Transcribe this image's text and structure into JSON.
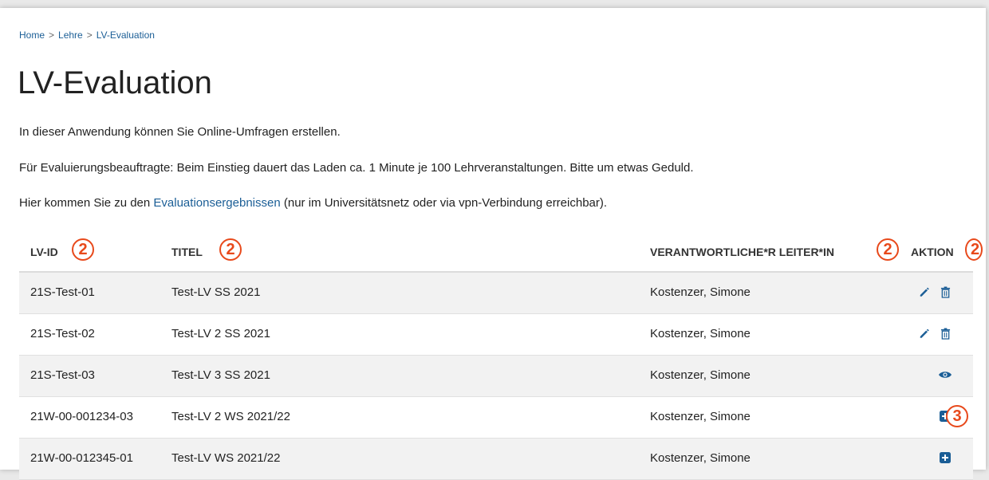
{
  "breadcrumb": {
    "home": "Home",
    "lehre": "Lehre",
    "current": "LV-Evaluation",
    "separator": ">"
  },
  "page": {
    "title": "LV-Evaluation",
    "intro1": "In dieser Anwendung können Sie Online-Umfragen erstellen.",
    "intro2": "Für Evaluierungsbeauftragte: Beim Einstieg dauert das Laden ca. 1 Minute je 100 Lehrveranstaltungen. Bitte um etwas Geduld.",
    "intro3_before": "Hier kommen Sie zu den ",
    "intro3_link": "Evaluationsergebnissen",
    "intro3_after": " (nur im Universitätsnetz oder via vpn-Verbindung erreichbar)."
  },
  "table": {
    "headers": {
      "lvid": "LV-ID",
      "titel": "TITEL",
      "leiter": "VERANTWORTLICHE*R LEITER*IN",
      "aktion": "AKTION"
    },
    "rows": [
      {
        "id": "21S-Test-01",
        "title": "Test-LV SS 2021",
        "leader": "Kostenzer, Simone",
        "actions": [
          "edit",
          "delete"
        ]
      },
      {
        "id": "21S-Test-02",
        "title": "Test-LV 2 SS 2021",
        "leader": "Kostenzer, Simone",
        "actions": [
          "edit",
          "delete"
        ]
      },
      {
        "id": "21S-Test-03",
        "title": "Test-LV 3 SS 2021",
        "leader": "Kostenzer, Simone",
        "actions": [
          "view"
        ]
      },
      {
        "id": "21W-00-001234-03",
        "title": "Test-LV 2 WS 2021/22",
        "leader": "Kostenzer, Simone",
        "actions": [
          "add"
        ]
      },
      {
        "id": "21W-00-012345-01",
        "title": "Test-LV WS 2021/22",
        "leader": "Kostenzer, Simone",
        "actions": [
          "add"
        ]
      }
    ]
  },
  "annotations": {
    "header_marker": "2",
    "row_marker": "3"
  },
  "colors": {
    "link": "#1b5e96",
    "icon": "#1b5e96",
    "annotation": "#e8491b",
    "row_stripe": "#f2f2f2"
  },
  "icons": {
    "edit": "pencil-icon",
    "delete": "trash-icon",
    "view": "eye-icon",
    "add": "plus-square-icon"
  }
}
